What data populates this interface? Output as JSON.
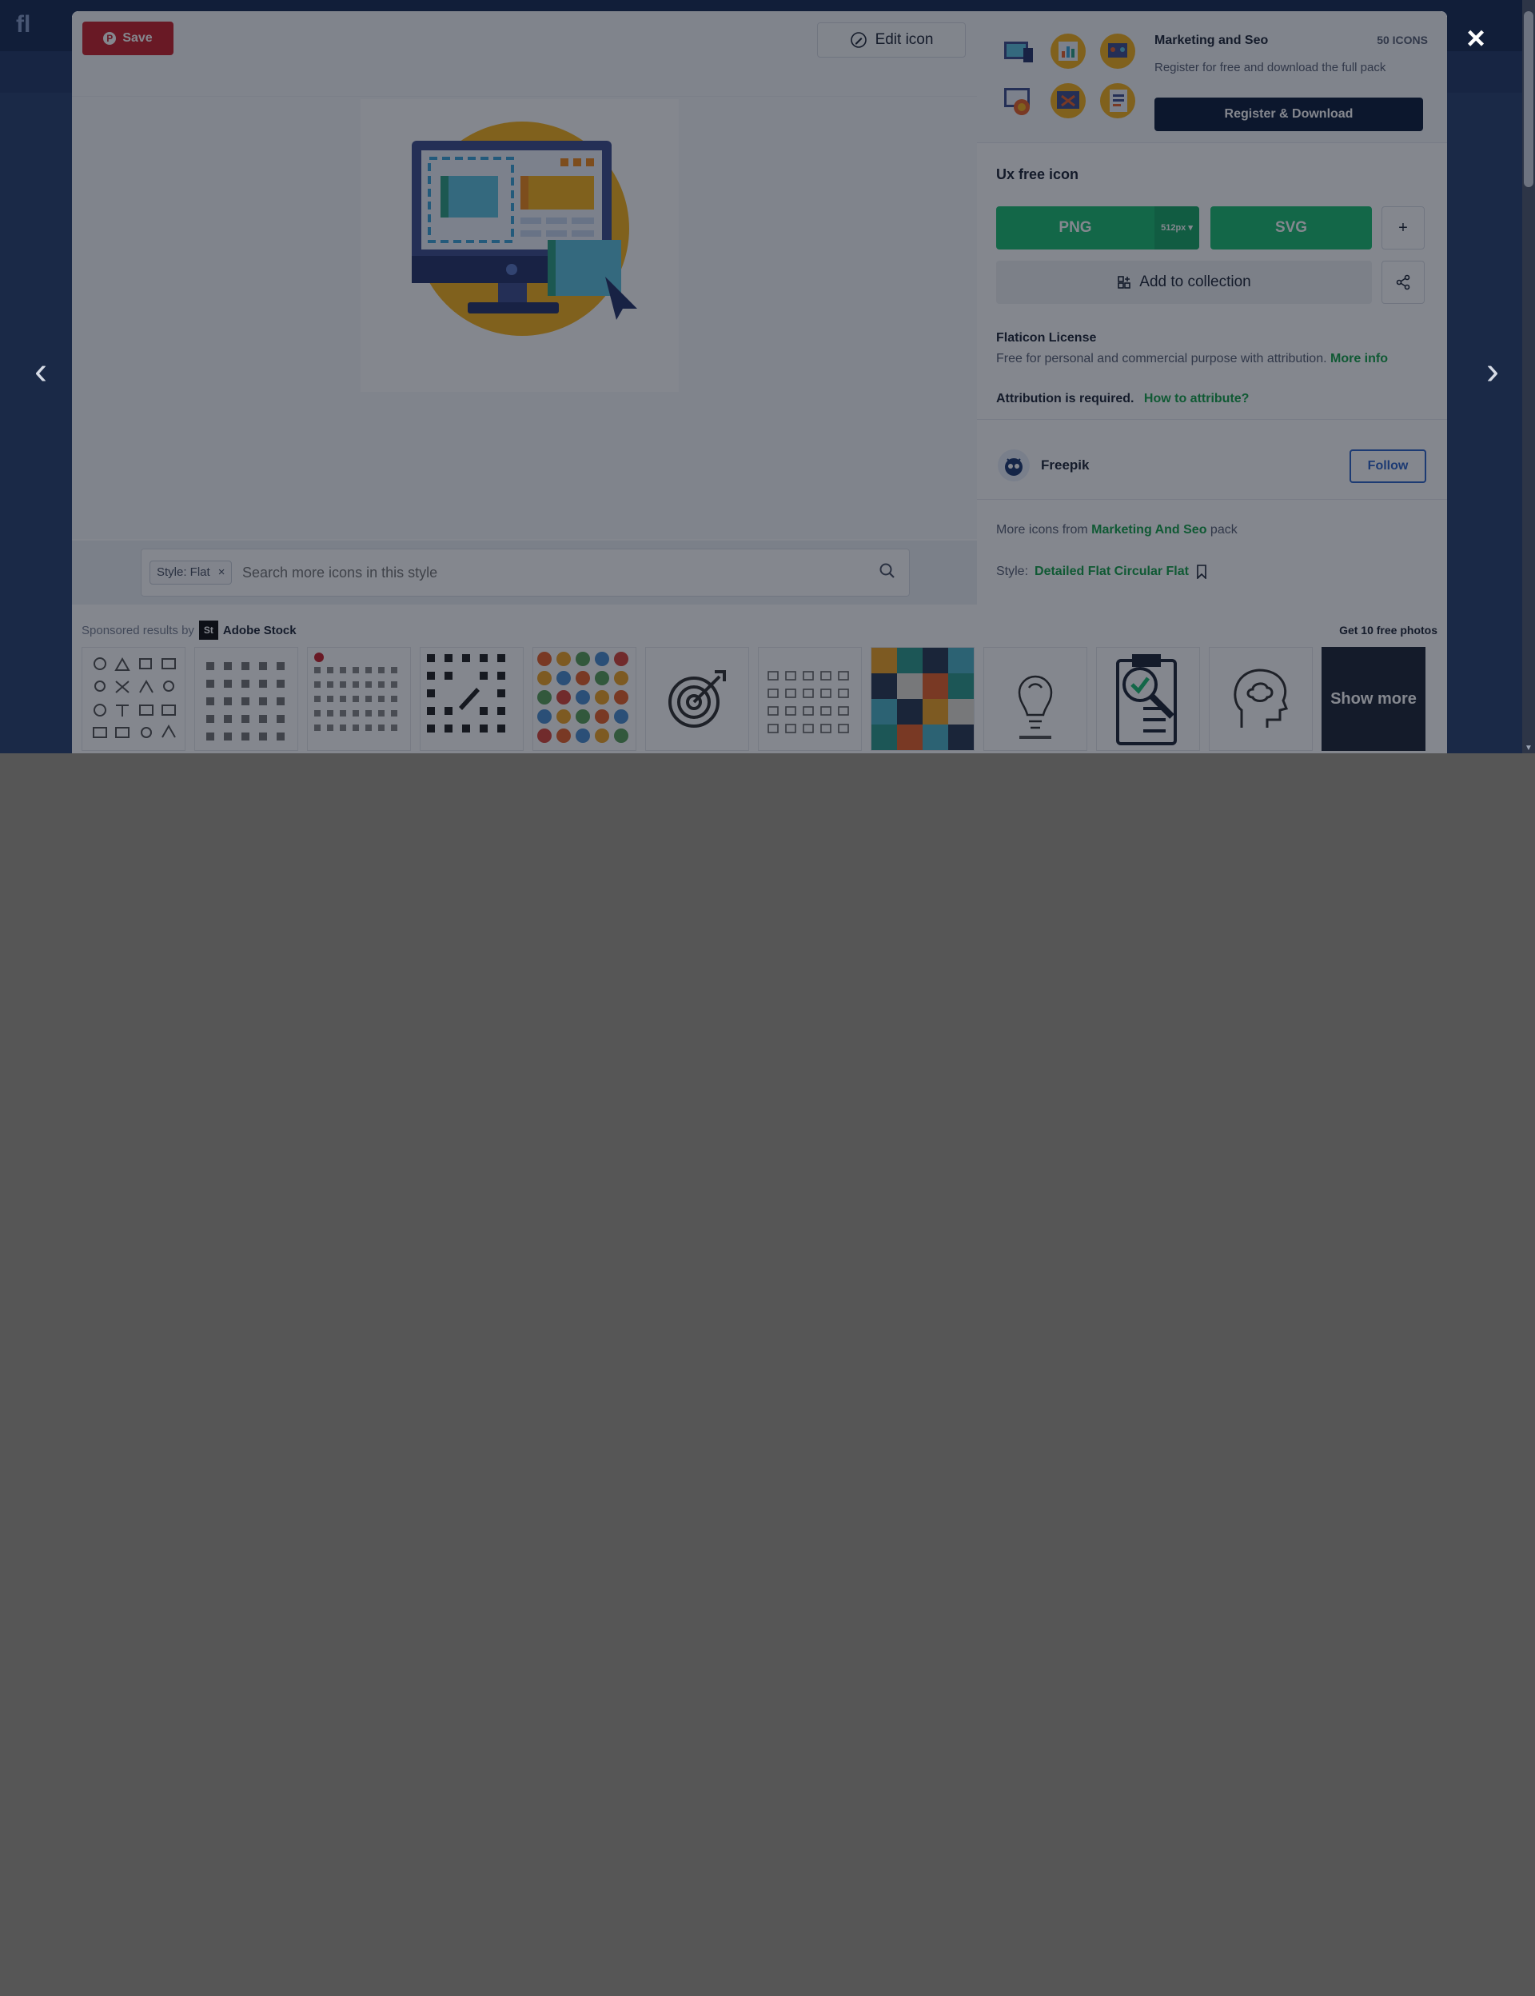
{
  "background_page": {
    "logo_text": "fl",
    "subnav_text": "..."
  },
  "modal": {
    "save_label": "Save",
    "edit_label": "Edit icon",
    "close_glyph": "×",
    "prev_glyph": "‹",
    "next_glyph": "›",
    "search": {
      "chip_label": "Style: Flat",
      "chip_remove": "×",
      "placeholder": "Search more icons in this style"
    },
    "sponsored": {
      "label": "Sponsored results by",
      "brand_mark": "St",
      "brand_name": "Adobe Stock",
      "get_photos": "Get 10 free photos",
      "show_more": "Show more"
    },
    "pack": {
      "title": "Marketing and Seo",
      "count": "50 ICONS",
      "description": "Register for free and download the full pack",
      "register_button": "Register & Download"
    },
    "icon": {
      "title": "Ux free icon",
      "png_label": "PNG",
      "png_size": "512px",
      "svg_label": "SVG",
      "plus": "+",
      "collection_label": "Add to collection"
    },
    "license": {
      "title": "Flaticon License",
      "desc": "Free for personal and commercial purpose with attribution.",
      "more_info": "More info",
      "attribution_required": "Attribution is required.",
      "how_to": "How to attribute?"
    },
    "author": {
      "name": "Freepik",
      "follow": "Follow"
    },
    "more_from": {
      "prefix": "More icons from",
      "pack_link": "Marketing And Seo",
      "suffix": "pack"
    },
    "style": {
      "label": "Style:",
      "link": "Detailed Flat Circular Flat"
    }
  },
  "colors": {
    "accent_green": "#1dbf73",
    "navy": "#0f1e3d",
    "pinterest_red": "#c8232c",
    "follow_blue": "#2f64c8"
  }
}
